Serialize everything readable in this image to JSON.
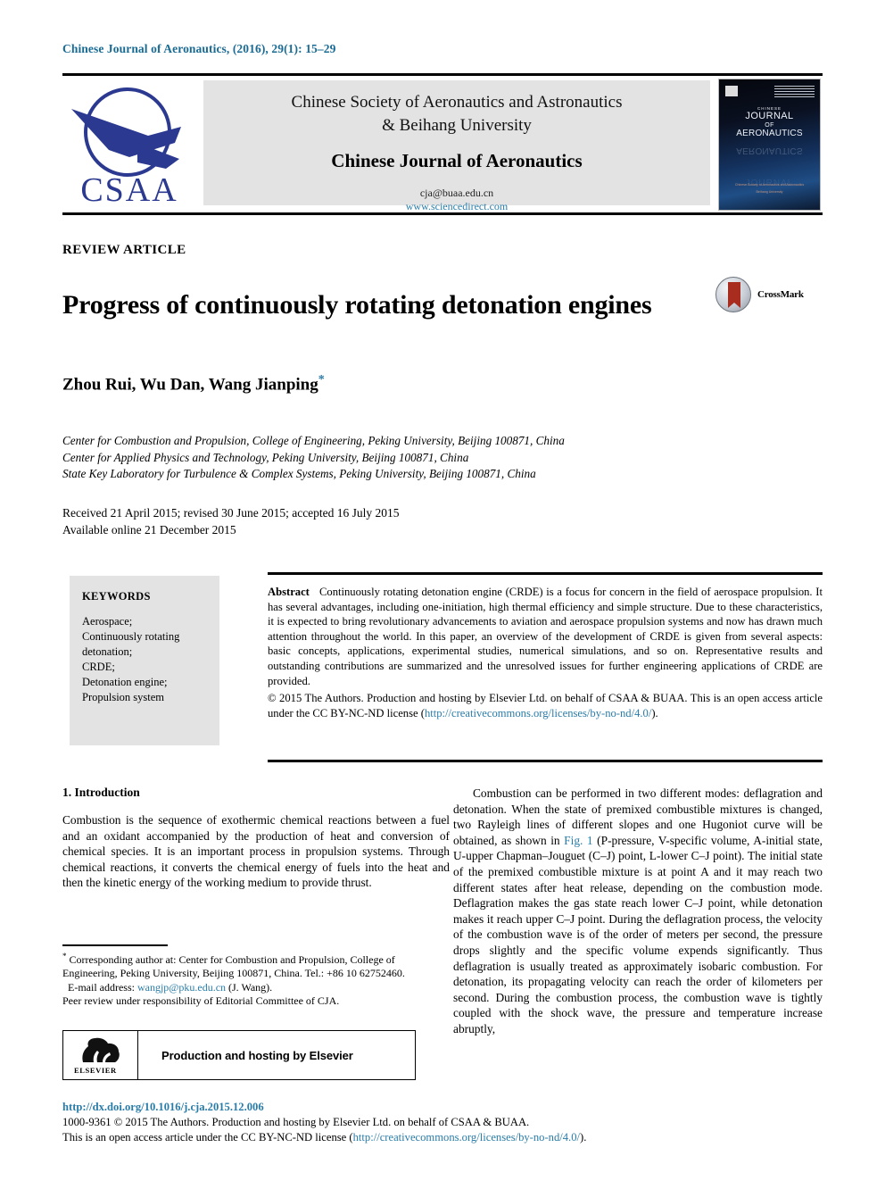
{
  "running_head": "Chinese Journal of Aeronautics, (2016), 29(1): 15–29",
  "masthead": {
    "society_line_1": "Chinese Society of Aeronautics and Astronautics",
    "society_line_2": "& Beihang University",
    "journal_title": "Chinese Journal of Aeronautics",
    "email": "cja@buaa.edu.cn",
    "website": "www.sciencedirect.com",
    "logo_text": "CSAA",
    "cover": {
      "line1": "CHINESE",
      "line2": "JOURNAL",
      "line3": "OF",
      "line4": "AERONAUTICS",
      "footer1": "Chinese Society of Aeronautics and Astronautics",
      "footer2": "Beihang University"
    }
  },
  "article": {
    "type": "REVIEW ARTICLE",
    "title": "Progress of continuously rotating detonation engines",
    "crossmark_label": "CrossMark",
    "authors": "Zhou Rui, Wu Dan, Wang Jianping",
    "author_marker": "*",
    "affiliations": [
      "Center for Combustion and Propulsion, College of Engineering, Peking University, Beijing 100871, China",
      "Center for Applied Physics and Technology, Peking University, Beijing 100871, China",
      "State Key Laboratory for Turbulence & Complex Systems, Peking University, Beijing 100871, China"
    ],
    "received_line": "Received 21 April 2015; revised 30 June 2015; accepted 16 July 2015",
    "available_line": "Available online 21 December 2015"
  },
  "keywords": {
    "heading": "KEYWORDS",
    "items": [
      "Aerospace;",
      "Continuously rotating",
      "detonation;",
      "CRDE;",
      "Detonation engine;",
      "Propulsion system"
    ]
  },
  "abstract": {
    "label": "Abstract",
    "text": "Continuously rotating detonation engine (CRDE) is a focus for concern in the field of aerospace propulsion. It has several advantages, including one-initiation, high thermal efficiency and simple structure. Due to these characteristics, it is expected to bring revolutionary advancements to aviation and aerospace propulsion systems and now has drawn much attention throughout the world. In this paper, an overview of the development of CRDE is given from several aspects: basic concepts, applications, experimental studies, numerical simulations, and so on. Representative results and outstanding contributions are summarized and the unresolved issues for further engineering applications of CRDE are provided.",
    "copyright": "© 2015 The Authors. Production and hosting by Elsevier Ltd. on behalf of CSAA & BUAA.  This is an open access article under the CC BY-NC-ND license (",
    "license_url": "http://creativecommons.org/licenses/by-no-nd/4.0/",
    "copyright_tail": ")."
  },
  "body": {
    "section_heading": "1. Introduction",
    "left_paragraph": "Combustion is the sequence of exothermic chemical reactions between a fuel and an oxidant accompanied by the production of heat and conversion of chemical species. It is an important process in propulsion systems. Through chemical reactions, it converts the chemical energy of fuels into the heat and then the kinetic energy of the working medium to provide thrust.",
    "right_paragraph_part1": "Combustion can be performed in two different modes: deflagration and detonation. When the state of premixed combustible mixtures is changed, two Rayleigh lines of different slopes and one Hugoniot curve will be obtained, as shown in ",
    "figure_ref": "Fig. 1",
    "right_paragraph_part2": " (P-pressure, V-specific volume, A-initial state, U-upper Chapman–Jouguet (C–J) point, L-lower C–J point). The initial state of the premixed combustible mixture is at point A and it may reach two different states after heat release, depending on the combustion mode. Deflagration makes the gas state reach lower C–J point, while detonation makes it reach upper C–J point. During the deflagration process, the velocity of the combustion wave is of the order of meters per second, the pressure drops slightly and the specific volume expends significantly. Thus deflagration is usually treated as approximately isobaric combustion. For detonation, its propagating velocity can reach the order of kilometers per second. During the combustion process, the combustion wave is tightly coupled with the shock wave, the pressure and temperature increase abruptly,"
  },
  "footnote": {
    "marker": "*",
    "corresponding": "Corresponding author at: Center for Combustion and Propulsion, College of Engineering, Peking University, Beijing 100871, China. Tel.: +86 10 62752460.",
    "email_label": "E-mail address:",
    "email": "wangjp@pku.edu.cn",
    "email_owner": "(J. Wang).",
    "peer_review": "Peer review under responsibility of Editorial Committee of CJA."
  },
  "elsevier_box": {
    "logo_word": "ELSEVIER",
    "text": "Production and hosting by Elsevier"
  },
  "footer": {
    "doi": "http://dx.doi.org/10.1016/j.cja.2015.12.006",
    "issn_line": "1000-9361 © 2015 The Authors. Production and hosting by Elsevier Ltd. on behalf of CSAA & BUAA.",
    "license_prefix": "This is an open access article under the CC BY-NC-ND license (",
    "license_url": "http://creativecommons.org/licenses/by-no-nd/4.0/",
    "license_tail": ")."
  },
  "colors": {
    "link": "#2a7ca8",
    "logo_blue": "#2b3990",
    "panel_gray": "#e3e3e3"
  }
}
